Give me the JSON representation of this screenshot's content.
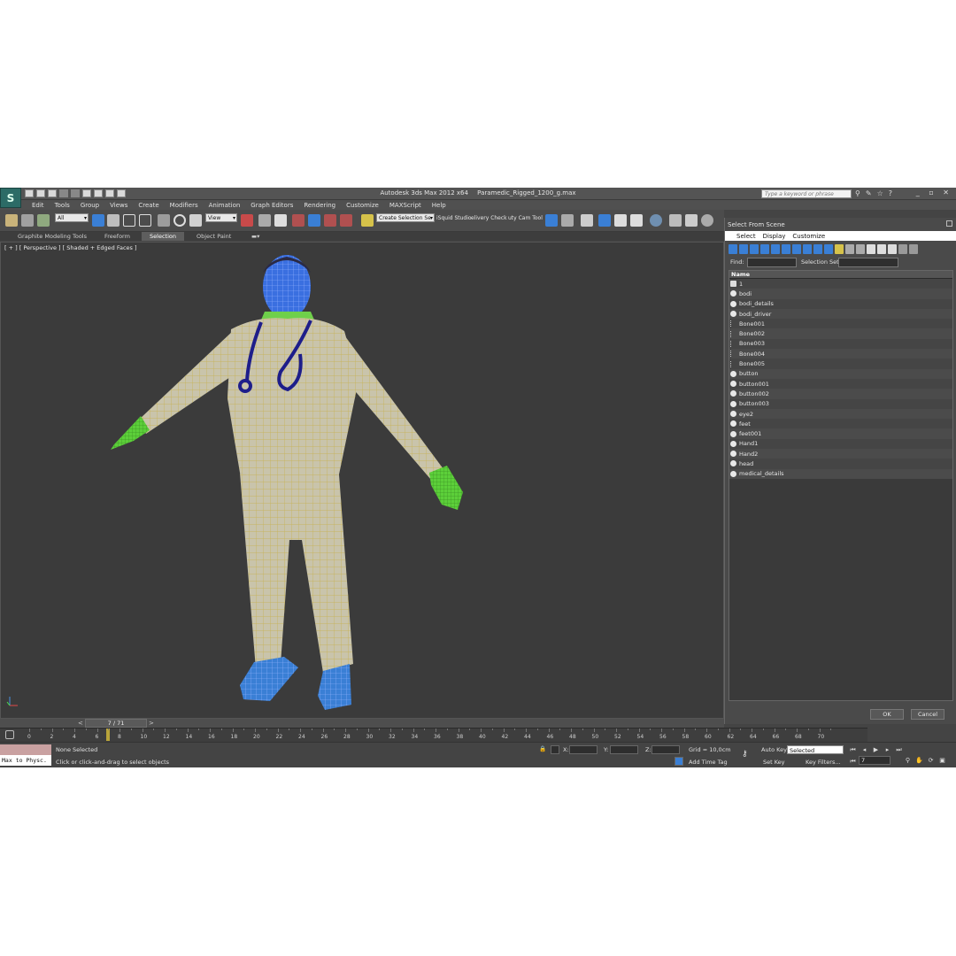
{
  "titlebar": {
    "app_name": "Autodesk 3ds Max  2012 x64",
    "file_name": "Paramedic_Rigged_1200_g.max",
    "search_placeholder": "Type a keyword or phrase"
  },
  "menu": [
    "Edit",
    "Tools",
    "Group",
    "Views",
    "Create",
    "Modifiers",
    "Animation",
    "Graph Editors",
    "Rendering",
    "Customize",
    "MAXScript",
    "Help"
  ],
  "toolbar": {
    "selection_filter": "All",
    "reference_coord": "View",
    "named_selection": "Create Selection Se",
    "plugin_1": "iSquid Studio",
    "plugin_2": "elivery Check",
    "plugin_3": "uty Cam Tool"
  },
  "ribbon_tabs": [
    "Graphite Modeling Tools",
    "Freeform",
    "Selection",
    "Object Paint"
  ],
  "ribbon_active": "Selection",
  "viewport": {
    "label": "[ + ] [ Perspective ] [ Shaded + Edged Faces ]"
  },
  "dialog": {
    "title": "Select From Scene",
    "menu": [
      "Select",
      "Display",
      "Customize"
    ],
    "find_label": "Find:",
    "selection_set_label": "Selection Set:",
    "column_header": "Name",
    "items": [
      "1",
      "bodi",
      "bodi_details",
      "bodi_driver",
      "Bone001",
      "Bone002",
      "Bone003",
      "Bone004",
      "Bone005",
      "button",
      "button001",
      "button002",
      "button003",
      "eye2",
      "feet",
      "feet001",
      "Hand1",
      "Hand2",
      "head",
      "medical_details"
    ],
    "item_types": [
      "group",
      "mesh",
      "mesh",
      "mesh",
      "bone",
      "bone",
      "bone",
      "bone",
      "bone",
      "mesh",
      "mesh",
      "mesh",
      "mesh",
      "mesh",
      "mesh",
      "mesh",
      "mesh",
      "mesh",
      "mesh",
      "mesh"
    ],
    "ok_label": "OK",
    "cancel_label": "Cancel"
  },
  "timeline": {
    "frame_display": "7 / 71",
    "ticks": [
      "0",
      "2",
      "4",
      "6",
      "8",
      "10",
      "12",
      "14",
      "16",
      "18",
      "20",
      "22",
      "24",
      "26",
      "28",
      "30",
      "32",
      "34",
      "36",
      "38",
      "40",
      "42",
      "44",
      "46",
      "48",
      "50",
      "52",
      "54",
      "56",
      "58",
      "60",
      "62",
      "64",
      "66",
      "68",
      "70"
    ],
    "current_frame": 7
  },
  "status": {
    "maxscript_text": "Max to Physc.",
    "selection_status": "None Selected",
    "prompt": "Click or click-and-drag to select objects",
    "x_label": "X:",
    "y_label": "Y:",
    "z_label": "Z:",
    "grid": "Grid = 10,0cm",
    "add_time_tag": "Add Time Tag",
    "auto_key": "Auto Key",
    "set_key": "Set Key",
    "key_mode": "Selected",
    "key_filters": "Key Filters...",
    "frame_field": "7"
  },
  "colors": {
    "viewport_bg": "#3b3b3b",
    "wire_yellow": "#d8c25a",
    "skin_blue": "#3a6fe0",
    "hands_green": "#5ccf3a",
    "highlight_blue": "#3a7fd5"
  }
}
